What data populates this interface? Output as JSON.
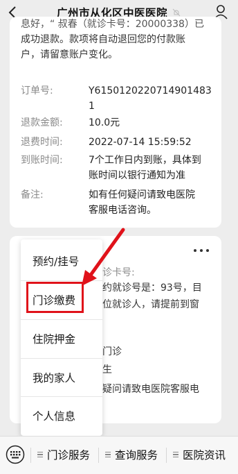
{
  "header": {
    "title": "广州市从化区中医医院",
    "icons": {
      "back": "back-chevron-icon",
      "mute": "mute-bell-icon",
      "profile": "user-icon"
    }
  },
  "refund_card": {
    "notice_line1": "息好，“ 叔春（就诊卡号：20000338）已",
    "notice_line2": "成功退款。款项将自动退回您的付款账",
    "notice_line3": "户，请留意账户变化。",
    "order_no_label": "订单号:",
    "order_no_value_1": "Y6150120220714901483",
    "order_no_value_2": "1",
    "amount_label": "退款金额:",
    "amount_value": "10.0元",
    "time_label": "退费时间:",
    "time_value": "2022-07-14 15:59:52",
    "arrival_label": "到账时间:",
    "arrival_value_1": "7个工作日内到账，具体到",
    "arrival_value_2": "账时间以银行通知为准",
    "remark_label": "备注:",
    "remark_value_1": "如有任何疑问请致电医院",
    "remark_value_2": "客服电话咨询。"
  },
  "second_card": {
    "line1": "诊卡号:",
    "line2": "约就诊号是：93号，目",
    "line3": "位就诊人，请提前到窗",
    "line4": "门诊",
    "line5": "生",
    "line6": "疑问请致电医院客服电",
    "more_icon": "more-dots-icon"
  },
  "menu": {
    "items": [
      "预约/挂号",
      "门诊缴费",
      "住院押金",
      "我的家人",
      "个人信息"
    ],
    "highlighted_item": "门诊缴费",
    "highlight_color": "#e0121a"
  },
  "bottom_bar": {
    "keyboard_icon": "keyboard-icon",
    "tabs": [
      "门诊服务",
      "查询服务",
      "医院资讯"
    ]
  }
}
